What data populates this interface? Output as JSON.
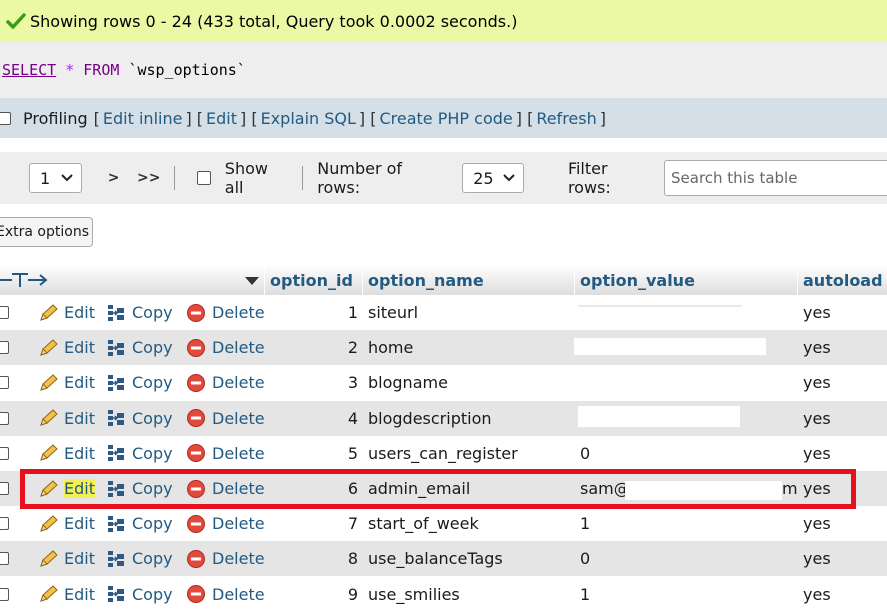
{
  "banner": {
    "message": "Showing rows 0 - 24 (433 total, Query took 0.0002 seconds.)",
    "icon": "checkmark-icon"
  },
  "sql": {
    "select": "SELECT",
    "star": "*",
    "from": "FROM",
    "table": "`wsp_options`"
  },
  "profiling": {
    "label": "Profiling",
    "links": [
      "Edit inline",
      "Edit",
      "Explain SQL",
      "Create PHP code",
      "Refresh"
    ]
  },
  "nav": {
    "page_value": "1",
    "next": ">",
    "last": ">>",
    "show_all": "Show all",
    "rows_label": "Number of rows:",
    "rows_value": "25",
    "filter_label": "Filter rows:",
    "search_placeholder": "Search this table"
  },
  "extra_options": "Extra options",
  "table": {
    "columns": [
      "option_id",
      "option_name",
      "option_value",
      "autoload"
    ],
    "actions": {
      "edit": "Edit",
      "copy": "Copy",
      "delete": "Delete"
    },
    "rows": [
      {
        "id": "1",
        "name": "siteurl",
        "value": "",
        "autoload": "yes"
      },
      {
        "id": "2",
        "name": "home",
        "value": "",
        "autoload": "yes"
      },
      {
        "id": "3",
        "name": "blogname",
        "value": "",
        "autoload": "yes"
      },
      {
        "id": "4",
        "name": "blogdescription",
        "value": "",
        "autoload": "yes"
      },
      {
        "id": "5",
        "name": "users_can_register",
        "value": "0",
        "autoload": "yes"
      },
      {
        "id": "6",
        "name": "admin_email",
        "value": "sam@",
        "value_tail": "m",
        "autoload": "yes"
      },
      {
        "id": "7",
        "name": "start_of_week",
        "value": "1",
        "autoload": "yes"
      },
      {
        "id": "8",
        "name": "use_balanceTags",
        "value": "0",
        "autoload": "yes"
      },
      {
        "id": "9",
        "name": "use_smilies",
        "value": "1",
        "autoload": "yes"
      }
    ]
  },
  "colors": {
    "link": "#235a81",
    "banner": "#ebf8a4",
    "highlight_box": "#e8101c",
    "edit_highlight": "#f3f050"
  }
}
